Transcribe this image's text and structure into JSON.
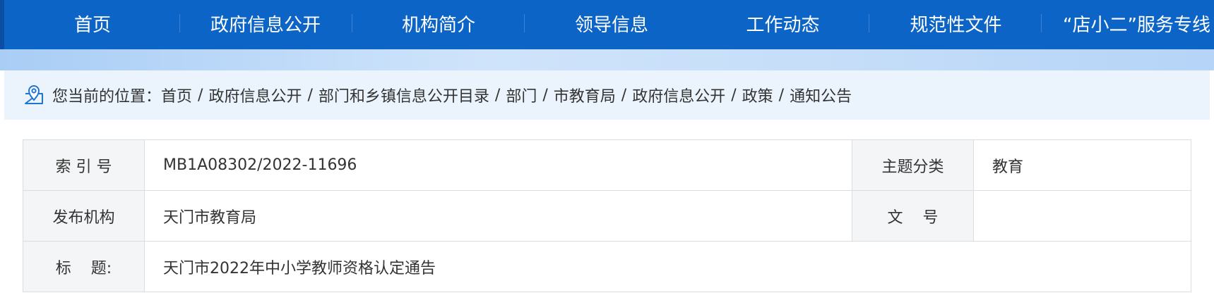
{
  "nav": {
    "items": [
      {
        "label": "首页"
      },
      {
        "label": "政府信息公开"
      },
      {
        "label": "机构简介"
      },
      {
        "label": "领导信息"
      },
      {
        "label": "工作动态"
      },
      {
        "label": "规范性文件"
      },
      {
        "label": "“店小二”服务专线"
      }
    ]
  },
  "breadcrumb": {
    "prefix": "您当前的位置：",
    "separator": "/",
    "items": [
      "首页",
      "政府信息公开",
      "部门和乡镇信息公开目录",
      "部门",
      "市教育局",
      "政府信息公开",
      "政策",
      "通知公告"
    ]
  },
  "meta": {
    "index_label": "索 引 号",
    "index_value": "MB1A08302/2022-11696",
    "topic_label": "主题分类",
    "topic_value": "教育",
    "publisher_label": "发布机构",
    "publisher_value": "天门市教育局",
    "docno_label": "文    号",
    "docno_value": "",
    "title_label": "标    题:",
    "title_value": "天门市2022年中小学教师资格认定通告"
  },
  "colors": {
    "nav_bg": "#0c64c6",
    "breadcrumb_bg": "#ebf4fd",
    "label_cell_bg": "#f4f5f7",
    "icon_blue": "#1f73d4"
  }
}
